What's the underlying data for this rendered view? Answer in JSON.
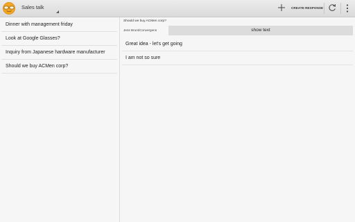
{
  "actionbar": {
    "app_icon": "glasses-face-icon",
    "title": "Sales talk",
    "create_response_label": "CREATE RESPONSE",
    "add_icon": "plus-icon",
    "refresh_icon": "refresh-icon",
    "overflow_icon": "overflow-menu-icon"
  },
  "topics": [
    {
      "label": "Dinner with management friday"
    },
    {
      "label": "Look at Google Glasses?"
    },
    {
      "label": "Inquiry from Japanese hardware manufacturer"
    },
    {
      "label": "Should we buy ACMen corp?"
    }
  ],
  "detail": {
    "subject": "Should we buy ACMen corp?",
    "author": "Jens Brunt/Convergens",
    "show_text_label": "show text",
    "responses": [
      {
        "text": "Great idea - let's get going"
      },
      {
        "text": "I am not so sure"
      }
    ]
  },
  "colors": {
    "actionbar_bg": "#e3e3e3",
    "background": "#f6f6f6",
    "button_bg": "#dcdcdc",
    "icon_orange": "#f0a020"
  }
}
